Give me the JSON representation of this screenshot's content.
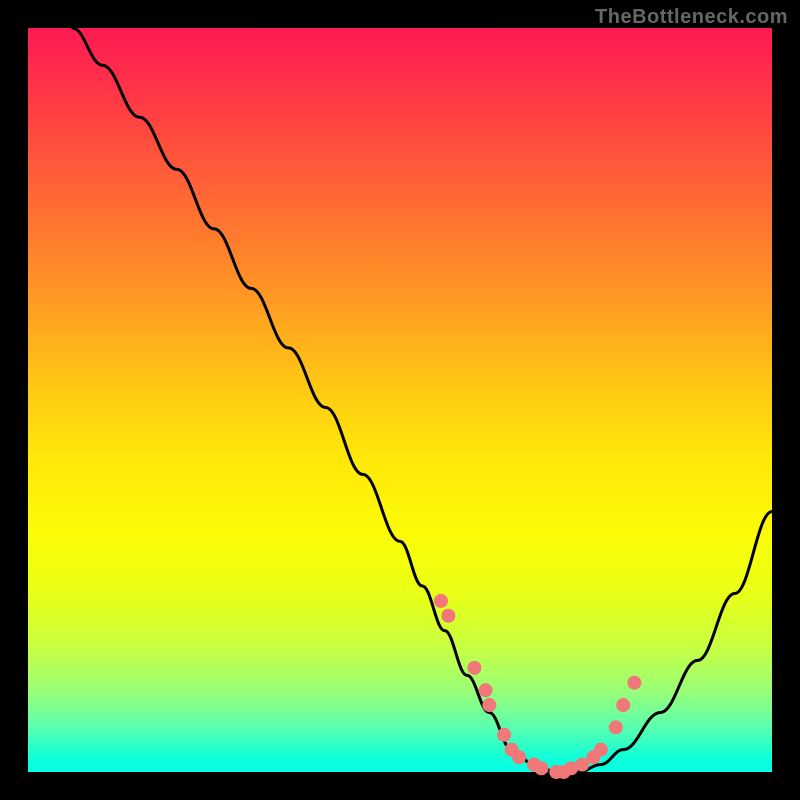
{
  "watermark": "TheBottleneck.com",
  "chart_data": {
    "type": "line",
    "title": "",
    "xlabel": "",
    "ylabel": "",
    "xlim": [
      0,
      100
    ],
    "ylim": [
      0,
      100
    ],
    "gradient_stops": [
      {
        "pos": 0,
        "color": "#ff1a53"
      },
      {
        "pos": 8,
        "color": "#ff3348"
      },
      {
        "pos": 18,
        "color": "#ff573a"
      },
      {
        "pos": 28,
        "color": "#ff7b2e"
      },
      {
        "pos": 38,
        "color": "#ffa021"
      },
      {
        "pos": 48,
        "color": "#ffc814"
      },
      {
        "pos": 58,
        "color": "#ffe80a"
      },
      {
        "pos": 68,
        "color": "#fcfc05"
      },
      {
        "pos": 76,
        "color": "#e9ff16"
      },
      {
        "pos": 83,
        "color": "#c9ff40"
      },
      {
        "pos": 89,
        "color": "#9bff76"
      },
      {
        "pos": 94,
        "color": "#5affae"
      },
      {
        "pos": 98,
        "color": "#10ffd8"
      },
      {
        "pos": 100,
        "color": "#03ffe5"
      }
    ],
    "series": [
      {
        "name": "bottleneck-curve",
        "x": [
          6,
          10,
          15,
          20,
          25,
          30,
          35,
          40,
          45,
          50,
          53,
          56,
          59,
          62,
          65,
          68,
          71,
          74,
          77,
          80,
          85,
          90,
          95,
          100
        ],
        "y": [
          100,
          95,
          88,
          81,
          73,
          65,
          57,
          49,
          40,
          31,
          25,
          19,
          13,
          8,
          3,
          1,
          0,
          0,
          1,
          3,
          8,
          15,
          24,
          35
        ]
      }
    ],
    "scatter_points": {
      "name": "data-dots",
      "color": "#f07878",
      "x": [
        55.5,
        56.5,
        60,
        61.5,
        62,
        64,
        65,
        66,
        68,
        69,
        71,
        72,
        73,
        74.5,
        76,
        77,
        79,
        80,
        81.5
      ],
      "y": [
        23,
        21,
        14,
        11,
        9,
        5,
        3,
        2,
        1,
        0.5,
        0,
        0,
        0.5,
        1,
        2,
        3,
        6,
        9,
        12
      ]
    }
  }
}
